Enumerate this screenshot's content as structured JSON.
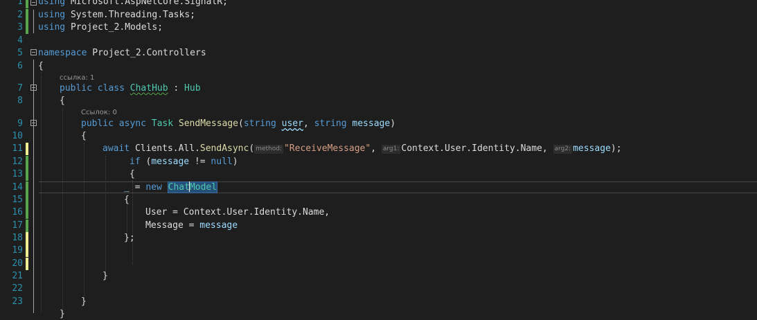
{
  "lines": [
    {
      "n": "1",
      "text": "using Microsoft.AspNetCore.SignalR;"
    },
    {
      "n": "2",
      "text": "using System.Threading.Tasks;"
    },
    {
      "n": "3",
      "text": "using Project_2.Models;"
    },
    {
      "n": "4",
      "text": ""
    },
    {
      "n": "5",
      "kw": "namespace",
      "rest": " Project_2.Controllers"
    },
    {
      "n": "6",
      "text": "{"
    },
    {
      "n": "7",
      "kw1": "public",
      "kw2": "class",
      "cls": "ChatHub",
      "sep": " : ",
      "base": "Hub"
    },
    {
      "n": "8",
      "text": "{"
    },
    {
      "n": "9",
      "kw1": "public",
      "kw2": "async",
      "ret": "Task",
      "fn": "SendMessage",
      "p1type": "string",
      "p1": "user",
      "p2type": "string",
      "p2": "message"
    },
    {
      "n": "10",
      "text": "{"
    },
    {
      "n": "11",
      "kw": "await",
      "call": " Clients.All.",
      "fn": "SendAsync",
      "h1": "method:",
      "s1": "\"ReceiveMessage\"",
      "h2": "arg1:",
      "a1": "Context.User.Identity.Name, ",
      "h3": "arg2:",
      "a2": "message",
      "end": ");"
    },
    {
      "n": "12",
      "kw": "if",
      "open": " (",
      "var": "message",
      "op": " != ",
      "null": "null",
      "close": ")"
    },
    {
      "n": "13",
      "text": "{"
    },
    {
      "n": "14",
      "us": "_",
      "eq": " = ",
      "kw": "new",
      "t1": "Chat",
      "t2": "Model"
    },
    {
      "n": "15",
      "text": "{"
    },
    {
      "n": "16",
      "text": "User = Context.User.Identity.Name,"
    },
    {
      "n": "17",
      "prop": "Message = ",
      "var": "message"
    },
    {
      "n": "18",
      "text": "};"
    },
    {
      "n": "19",
      "text": ""
    },
    {
      "n": "20",
      "text": ""
    },
    {
      "n": "21",
      "text": "}"
    },
    {
      "n": "22",
      "text": ""
    },
    {
      "n": "23",
      "text": "}"
    }
  ],
  "lens": {
    "class_refs": "ссылка: 1",
    "method_refs": "Ссылок: 0"
  },
  "colors": {
    "background": "#1e1e1e",
    "keyword": "#569cd6",
    "type": "#4ec9b0",
    "function": "#dcdcaa",
    "variable": "#9cdcfe",
    "string": "#d69d85",
    "line_number": "#2b91af"
  }
}
